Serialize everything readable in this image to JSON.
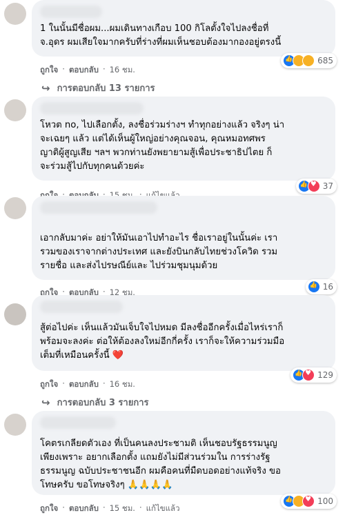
{
  "comments": [
    {
      "text": "1 ในนั้นมีชื่อผม...ผมเดินทางเกือบ 100 กิโลตั้งใจไปลงชื่อที่\nจ.อุดร ผมเสียใจมากครับที่ร่างที่ผมเห็นชอบต้องมากองอยู่ตรงนี้",
      "like": "ถูกใจ",
      "reply": "ตอบกลับ",
      "time": "16 ชม.",
      "edited": "",
      "reactions": [
        "like",
        "sad",
        "care"
      ],
      "count": "685",
      "replies": "การตอบกลับ 13 รายการ"
    },
    {
      "text": "โหวต no, ไปเลือกตั้ง, ลงชื่อร่วมร่างฯ ทำทุกอย่างแล้ว จริงๆ น่า\nจะเฉยๆ แล้ว แต่ได้เห็นผู้ใหญ่อย่างคุณจอน, คุณหมอทศพร\nญาติผู้สูญเสีย ฯลฯ พวกท่านยังพยายามสู้เพื่อประชาธิปไตย ก็\nจะร่วมสู้ไปกับทุกคนด้วยค่ะ",
      "like": "ถูกใจ",
      "reply": "ตอบกลับ",
      "time": "15 ชม.",
      "edited": "แก้ไขแล้ว",
      "reactions": [
        "like",
        "love"
      ],
      "count": "37",
      "replies": ""
    },
    {
      "text": "เอากลับมาค่ะ อย่าให้มันเอาไปทำอะไร ชื่อเราอยู่ในนั้นค่ะ เรา\nรวมของเราจากต่างประเทศ และยังบินกลับไทยช่วงโควิด รวม\nรายชื่อ และส่งไปรษณีย์และ ไปร่วมชุมนุมด้วย",
      "like": "ถูกใจ",
      "reply": "ตอบกลับ",
      "time": "12 ชม.",
      "edited": "",
      "reactions": [
        "like"
      ],
      "count": "16",
      "replies": ""
    },
    {
      "text": "สู้ต่อไปค่ะ เห็นแล้วมันเจ็บใจไปหมด มีลงชื่ออีกครั้งเมื่อไหร่เราก็\nพร้อมจะลงค่ะ ต่อให้ต้องลงใหม่อีกกี่ครั้ง เราก็จะให้ความร่วมมือ\nเต็มที่เหมือนครั้งนี้ ❤️",
      "like": "ถูกใจ",
      "reply": "ตอบกลับ",
      "time": "16 ชม.",
      "edited": "",
      "reactions": [
        "like",
        "love"
      ],
      "count": "129",
      "replies": "การตอบกลับ 3 รายการ"
    },
    {
      "text": "โคตรเกลียดตัวเอง ที่เป็นคนลงประชามติ เห็นชอบรัฐธรรมนูญ\nเพียงเพราะ อยากเลือกตั้ง แถมยังไม่มีส่วนร่วมใน การร่างรัฐ\nธรรมนูญ ฉบับประชาชนอีก ผมคือคนที่มืดบอดอย่างแท้จริง ขอ\nโทษครับ ขอโทษจริงๆ 🙏🙏🙏🙏",
      "like": "ถูกใจ",
      "reply": "ตอบกลับ",
      "time": "15 ชม.",
      "edited": "แก้ไขแล้ว",
      "reactions": [
        "like",
        "care",
        "love"
      ],
      "count": "100",
      "replies": ""
    }
  ],
  "sep": "·"
}
